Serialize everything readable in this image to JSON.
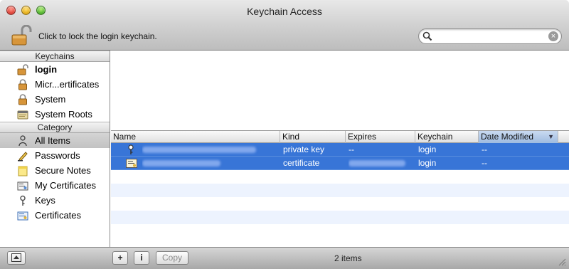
{
  "window": {
    "title": "Keychain Access"
  },
  "toolbar": {
    "lock_text": "Click to lock the login keychain.",
    "search_placeholder": ""
  },
  "sidebar": {
    "keychains_header": "Keychains",
    "keychains": [
      {
        "label": "login",
        "icon": "unlocked-padlock-icon"
      },
      {
        "label": "Micr...ertificates",
        "icon": "padlock-icon"
      },
      {
        "label": "System",
        "icon": "padlock-icon"
      },
      {
        "label": "System Roots",
        "icon": "folder-icon"
      }
    ],
    "category_header": "Category",
    "categories": [
      {
        "label": "All Items",
        "icon": "people-icon"
      },
      {
        "label": "Passwords",
        "icon": "pencil-icon"
      },
      {
        "label": "Secure Notes",
        "icon": "note-icon"
      },
      {
        "label": "My Certificates",
        "icon": "my-certificate-icon"
      },
      {
        "label": "Keys",
        "icon": "key-icon"
      },
      {
        "label": "Certificates",
        "icon": "certificate-icon"
      }
    ]
  },
  "table": {
    "columns": [
      "Name",
      "Kind",
      "Expires",
      "Keychain",
      "Date Modified"
    ],
    "sorted_column": "Date Modified",
    "rows": [
      {
        "name": "",
        "kind": "private key",
        "expires": "--",
        "keychain": "login",
        "date_modified": "--",
        "icon": "key-icon"
      },
      {
        "name": "",
        "kind": "certificate",
        "expires": "",
        "keychain": "login",
        "date_modified": "--",
        "icon": "certificate-icon"
      }
    ]
  },
  "bottombar": {
    "add_label": "+",
    "info_label": "i",
    "copy_label": "Copy",
    "items_count": "2 items"
  },
  "colors": {
    "selection": "#3875d7",
    "alt_row": "#edf3fe",
    "sidebar_selected": "#c8c8c8"
  }
}
